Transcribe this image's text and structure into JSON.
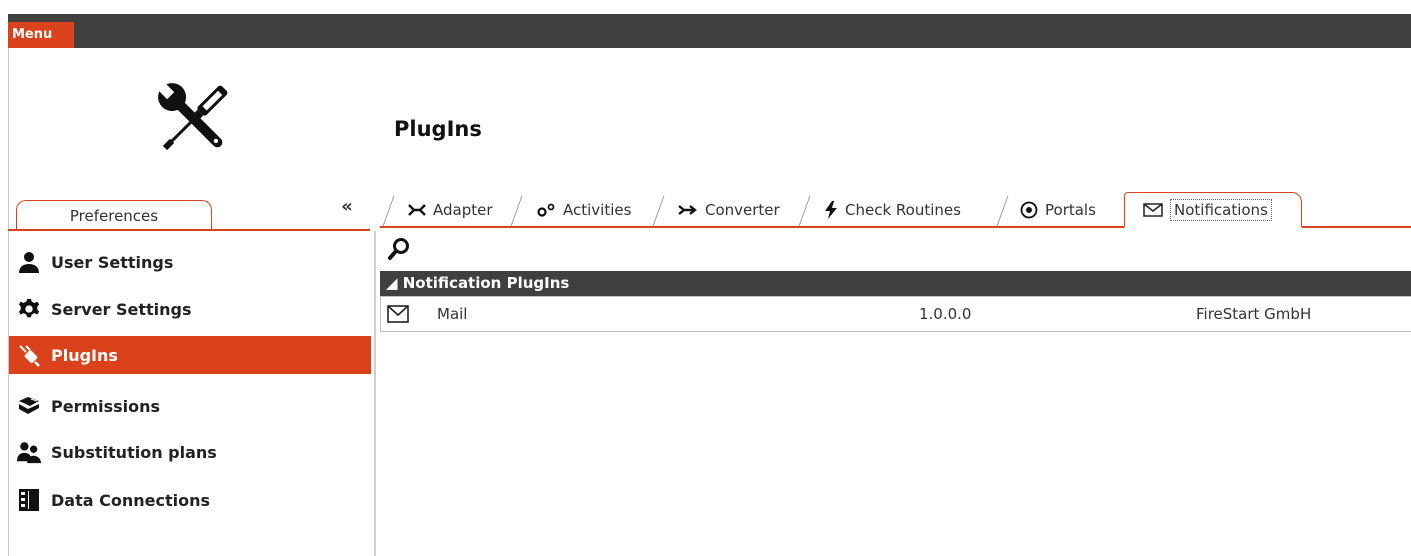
{
  "menu": {
    "label": "Menu"
  },
  "app": {
    "logo_icon": "wrench-screwdriver-icon"
  },
  "page": {
    "title": "PlugIns"
  },
  "sidebar": {
    "tab_label": "Preferences",
    "collapse_label": "«",
    "items": [
      {
        "label": "User Settings",
        "icon": "user-icon"
      },
      {
        "label": "Server Settings",
        "icon": "gear-icon"
      },
      {
        "label": "PlugIns",
        "icon": "plugin-icon",
        "active": true
      },
      {
        "label": "Permissions",
        "icon": "permissions-icon"
      },
      {
        "label": "Substitution plans",
        "icon": "users-icon"
      },
      {
        "label": "Data Connections",
        "icon": "database-icon"
      }
    ]
  },
  "tabs": [
    {
      "label": "Adapter",
      "icon": "adapter-icon"
    },
    {
      "label": "Activities",
      "icon": "activities-icon"
    },
    {
      "label": "Converter",
      "icon": "converter-icon"
    },
    {
      "label": "Check Routines",
      "icon": "lightning-icon"
    },
    {
      "label": "Portals",
      "icon": "portal-icon"
    },
    {
      "label": "Notifications",
      "icon": "envelope-icon",
      "active": true
    }
  ],
  "content": {
    "group_header": "◢ Notification PlugIns",
    "rows": [
      {
        "name": "Mail",
        "version": "1.0.0.0",
        "vendor": "FireStart GmbH",
        "icon": "envelope-icon"
      }
    ]
  },
  "colors": {
    "accent": "#d9421b",
    "bar": "#404040"
  }
}
